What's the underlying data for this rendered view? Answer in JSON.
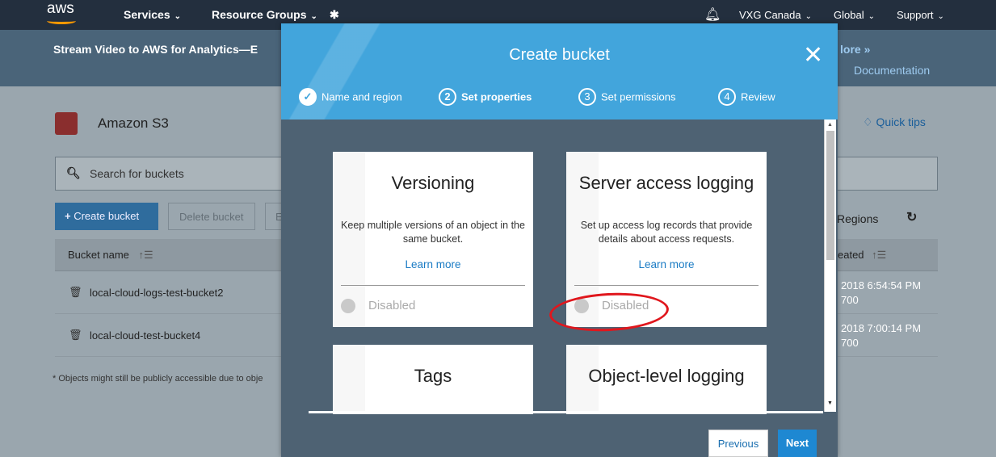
{
  "nav": {
    "logo": "aws",
    "services": "Services",
    "resource_groups": "Resource Groups",
    "account": "VXG Canada",
    "region": "Global",
    "support": "Support"
  },
  "banner": {
    "text": "Stream Video to AWS for Analytics—E",
    "more": "lore »",
    "documentation": "Documentation"
  },
  "s3": {
    "title": "Amazon S3",
    "quick_tips": "Quick tips",
    "search_placeholder": "Search for buckets",
    "create_bucket": "Create bucket",
    "delete_bucket": "Delete bucket",
    "partial_button": "E",
    "regions": "Regions",
    "col_bucket_name": "Bucket name",
    "col_created": "eated",
    "sort_indicator": "↑☰",
    "rows": [
      {
        "name": "local-cloud-logs-test-bucket2",
        "date_line1": "2018 6:54:54 PM",
        "date_line2": "700"
      },
      {
        "name": "local-cloud-test-bucket4",
        "date_line1": "2018 7:00:14 PM",
        "date_line2": "700"
      }
    ],
    "footnote": "* Objects might still be publicly accessible due to obje"
  },
  "modal": {
    "title": "Create bucket",
    "steps": [
      {
        "num": "✓",
        "label": "Name and region"
      },
      {
        "num": "2",
        "label": "Set properties"
      },
      {
        "num": "3",
        "label": "Set permissions"
      },
      {
        "num": "4",
        "label": "Review"
      }
    ],
    "cards": [
      {
        "title": "Versioning",
        "desc": "Keep multiple versions of an object in the same bucket.",
        "learn": "Learn more",
        "status": "Disabled"
      },
      {
        "title": "Server access logging",
        "desc": "Set up access log records that provide details about access requests.",
        "learn": "Learn more",
        "status": "Disabled"
      },
      {
        "title": "Tags"
      },
      {
        "title": "Object-level logging"
      }
    ],
    "previous": "Previous",
    "next": "Next"
  },
  "colors": {
    "header_blue": "#42a5dc",
    "modal_bg": "#4e6273",
    "annotation_red": "#e0171d",
    "nav_bg": "#232f3e"
  }
}
